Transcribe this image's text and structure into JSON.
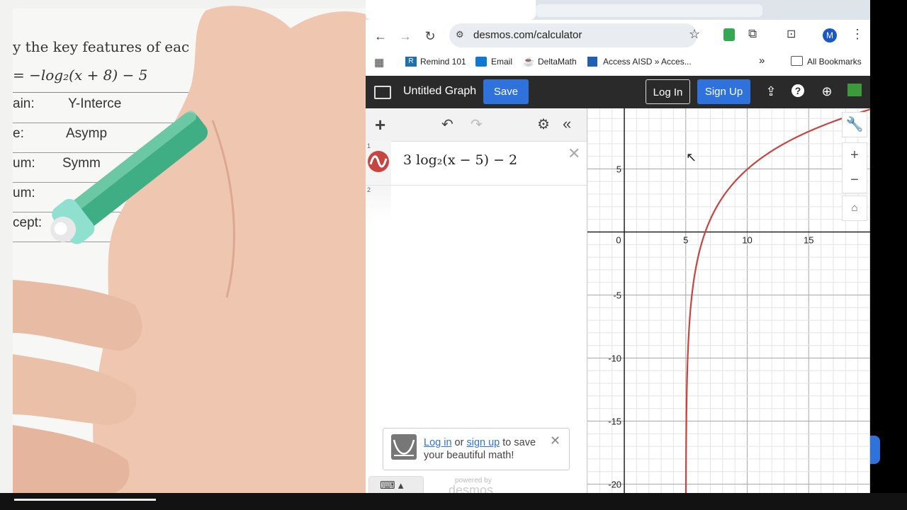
{
  "worksheet": {
    "instruction": "y the key features of eac",
    "equation": "= −log₂(x + 8) − 5",
    "rows": [
      {
        "left": "ain:",
        "right": "Y-Interce"
      },
      {
        "left": "e:",
        "right": "Asymp"
      },
      {
        "left": "um:",
        "right": "Symm"
      },
      {
        "left": "um:",
        "right": ""
      },
      {
        "left": "cept:",
        "right": ""
      }
    ]
  },
  "browser": {
    "url": "desmos.com/calculator",
    "profile_initial": "M",
    "bookmarks": [
      "Remind 101",
      "Email",
      "DeltaMath",
      "Access AISD » Acces...",
      "»",
      "All Bookmarks"
    ]
  },
  "desmos": {
    "title": "Untitled Graph",
    "save_label": "Save",
    "login_label": "Log In",
    "signup_label": "Sign Up",
    "expressions": [
      {
        "index": "1",
        "latex": "3 log₂(x − 5) − 2"
      },
      {
        "index": "2",
        "latex": ""
      }
    ],
    "toast": {
      "login": "Log in",
      "or": "or",
      "signup": "sign up",
      "rest": "to save your beautiful math!"
    },
    "powered_by": "powered by",
    "brand": "desmos",
    "curve_color": "#c74440"
  },
  "chart_data": {
    "type": "line",
    "x_ticks": [
      "0",
      "5",
      "10",
      "15"
    ],
    "y_ticks": [
      "5",
      "-5",
      "-10",
      "-15",
      "-20"
    ],
    "xlim": [
      -3,
      20
    ],
    "ylim": [
      -20.7,
      9.8
    ],
    "series": [
      {
        "values_fn": "3*log2(x-5)-2",
        "color": "#c74440"
      }
    ]
  }
}
